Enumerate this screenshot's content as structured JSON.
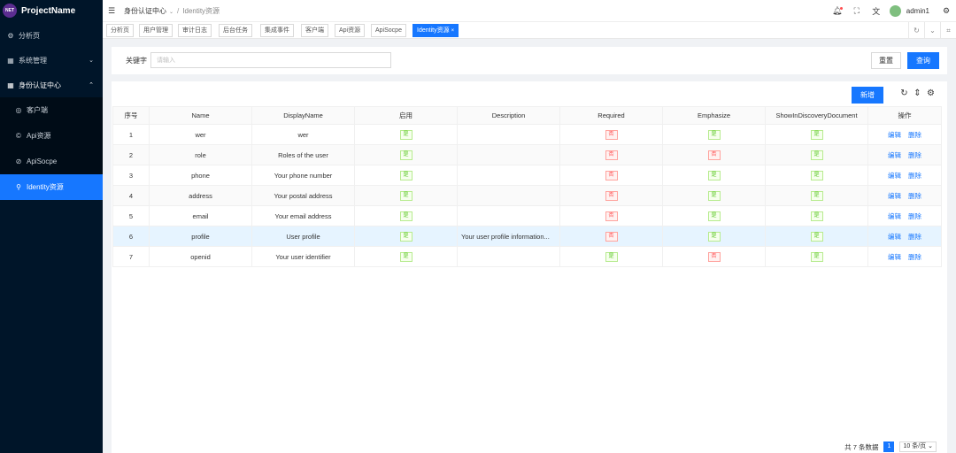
{
  "sidebar": {
    "logo_badge": "NET",
    "app_name": "ProjectName",
    "items": [
      {
        "label": "分析页",
        "icon": "dashboard-icon"
      },
      {
        "label": "系统管理",
        "icon": "appstore-icon"
      },
      {
        "label": "身份认证中心",
        "icon": "appstore-icon"
      }
    ],
    "subitems": [
      {
        "label": "客户端",
        "icon": "client-icon"
      },
      {
        "label": "Api资源",
        "icon": "api-icon"
      },
      {
        "label": "ApiSocpe",
        "icon": "scope-icon"
      },
      {
        "label": "Identity资源",
        "icon": "identity-icon"
      }
    ]
  },
  "header": {
    "breadcrumb_root": "身份认证中心",
    "breadcrumb_sep": "/",
    "breadcrumb_current": "Identity资源",
    "username": "admin1"
  },
  "tabs": [
    {
      "label": "分析页"
    },
    {
      "label": "用户管理"
    },
    {
      "label": "审计日志"
    },
    {
      "label": "后台任务"
    },
    {
      "label": "集成事件"
    },
    {
      "label": "客户端"
    },
    {
      "label": "Api资源"
    },
    {
      "label": "ApiSocpe"
    },
    {
      "label": "Identity资源",
      "close": "×"
    }
  ],
  "search": {
    "label": "关键字",
    "placeholder": "请输入",
    "value": "",
    "reset_label": "重置",
    "query_label": "查询"
  },
  "toolbar": {
    "add_label": "新增"
  },
  "table": {
    "headers": [
      "序号",
      "Name",
      "DisplayName",
      "启用",
      "Description",
      "Required",
      "Emphasize",
      "ShowInDiscoveryDocument",
      "操作"
    ],
    "rows": [
      {
        "index": "1",
        "name": "wer",
        "display": "wer",
        "enabled": "是",
        "description": "",
        "required": "否",
        "emphasize": "是",
        "show": "是"
      },
      {
        "index": "2",
        "name": "role",
        "display": "Roles of the user",
        "enabled": "是",
        "description": "",
        "required": "否",
        "emphasize": "否",
        "show": "是"
      },
      {
        "index": "3",
        "name": "phone",
        "display": "Your phone number",
        "enabled": "是",
        "description": "",
        "required": "否",
        "emphasize": "是",
        "show": "是"
      },
      {
        "index": "4",
        "name": "address",
        "display": "Your postal address",
        "enabled": "是",
        "description": "",
        "required": "否",
        "emphasize": "是",
        "show": "是"
      },
      {
        "index": "5",
        "name": "email",
        "display": "Your email address",
        "enabled": "是",
        "description": "",
        "required": "否",
        "emphasize": "是",
        "show": "是"
      },
      {
        "index": "6",
        "name": "profile",
        "display": "User profile",
        "enabled": "是",
        "description": "Your user profile information...",
        "required": "否",
        "emphasize": "是",
        "show": "是"
      },
      {
        "index": "7",
        "name": "openid",
        "display": "Your user identifier",
        "enabled": "是",
        "description": "",
        "required": "是",
        "emphasize": "否",
        "show": "是"
      }
    ],
    "edit_label": "编辑",
    "delete_label": "删除"
  },
  "pagination": {
    "total": "共 7 条数据",
    "current_page": "1",
    "page_size": "10 条/页"
  },
  "colors": {
    "sidebar_bg": "#001529",
    "primary": "#1677ff",
    "yes": "#52c41a",
    "no": "#ff4d4f"
  }
}
